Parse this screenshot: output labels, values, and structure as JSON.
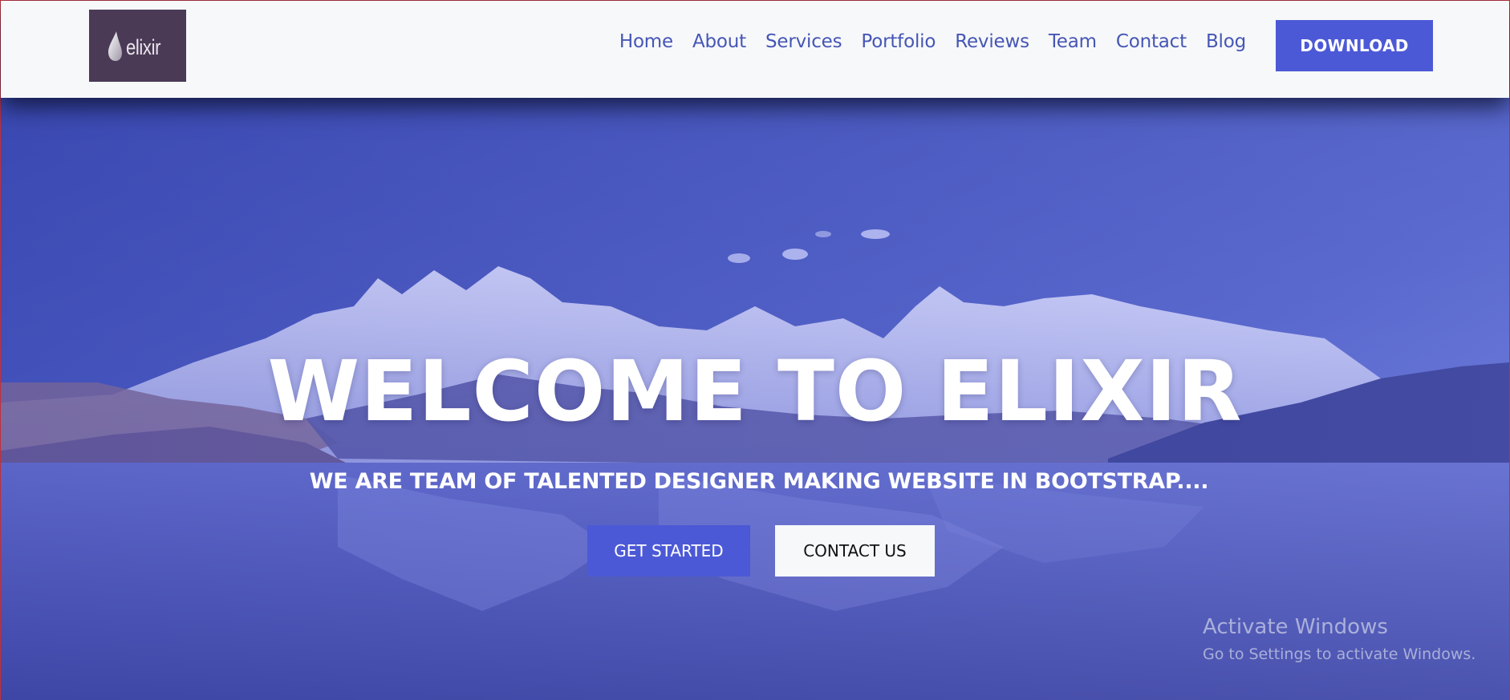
{
  "brand": {
    "logo_text": "elixir",
    "logo_bg": "#4a3a56",
    "icon": "water-drop-icon"
  },
  "nav": {
    "items": [
      {
        "label": "Home"
      },
      {
        "label": "About"
      },
      {
        "label": "Services"
      },
      {
        "label": "Portfolio"
      },
      {
        "label": "Reviews"
      },
      {
        "label": "Team"
      },
      {
        "label": "Contact"
      },
      {
        "label": "Blog"
      }
    ],
    "download_label": "DOWNLOAD",
    "link_color": "#4656b5",
    "accent": "#4c59d6"
  },
  "hero": {
    "title": "WELCOME TO ELIXIR",
    "subtitle": "WE ARE TEAM OF TALENTED DESIGNER MAKING WEBSITE IN BOOTSTRAP....",
    "primary_button": "GET STARTED",
    "secondary_button": "CONTACT US",
    "background": "mountain-lake-photo"
  },
  "watermark": {
    "title": "Activate Windows",
    "subtitle": "Go to Settings to activate Windows."
  }
}
